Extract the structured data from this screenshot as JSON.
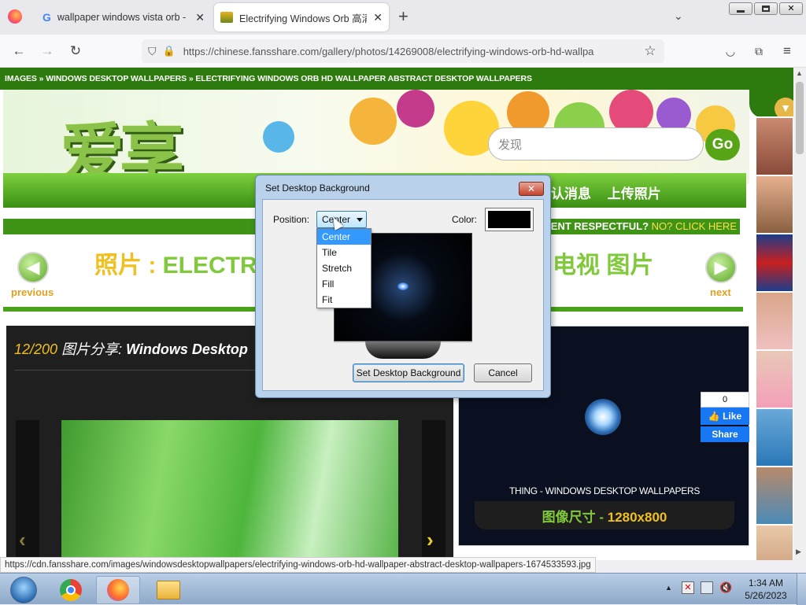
{
  "browser": {
    "tabs": [
      {
        "title": "wallpaper windows vista orb - G",
        "icon": "google-icon"
      },
      {
        "title": "Electrifying Windows Orb 高清晰",
        "icon": "fansshare-icon"
      }
    ],
    "new_tab_label": "+",
    "url": "https://chinese.fansshare.com/gallery/photos/14269008/electrifying-windows-orb-hd-wallpa",
    "status_url": "https://cdn.fansshare.com/images/windowsdesktopwallpapers/electrifying-windows-orb-hd-wallpaper-abstract-desktop-wallpapers-1674533593.jpg"
  },
  "page": {
    "breadcrumb": "IMAGES » WINDOWS DESKTOP WALLPAPERS » ELECTRIFYING WINDOWS ORB HD WALLPAPER ABSTRACT DESKTOP WALLPAPERS",
    "logo_text": "爱享",
    "search_placeholder": "发现",
    "go_label": "Go",
    "menu_text": "认消息 上传照片",
    "respect_text": "ENT RESPECTFUL?",
    "respect_link": " NO? CLICK HERE",
    "previous_label": "previous",
    "next_label": "next",
    "photo_title_prefix": "照片 :",
    "photo_title": " ELECTRIFYI",
    "photo_title_tail": "电视 图片",
    "counter_num": "12/200",
    "counter_label": " 图片分享: ",
    "counter_title": "Windows Desktop",
    "caption_line1": "THING - WINDOWS DESKTOP WALLPAPERS",
    "caption_size_label": "图像尺寸 - ",
    "caption_size_value": "1280x800",
    "like_count": "0",
    "like_label": "Like",
    "share_label": "Share"
  },
  "dialog": {
    "title": "Set Desktop Background",
    "position_label": "Position:",
    "position_value": "Center",
    "position_options": [
      "Center",
      "Tile",
      "Stretch",
      "Fill",
      "Fit"
    ],
    "color_label": "Color:",
    "color_value": "#000000",
    "set_button": "Set Desktop Background",
    "cancel_button": "Cancel"
  },
  "taskbar": {
    "time": "1:34 AM",
    "date": "5/26/2023"
  }
}
